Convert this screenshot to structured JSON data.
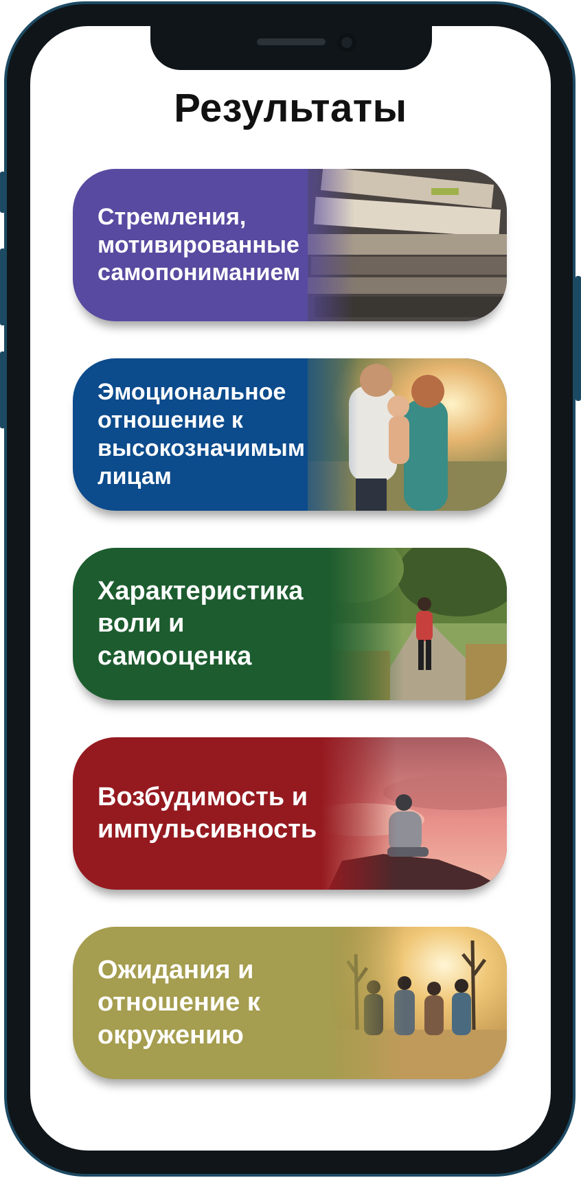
{
  "title": "Результаты",
  "cards": [
    {
      "label": "Стремления,\nмотивированные\nсамопониманием",
      "color": "#574aa0",
      "photo_icon": "books-photo"
    },
    {
      "label": "Эмоциональное\nотношение к\nвысокозначимым\nлицам",
      "color": "#0c4b8c",
      "photo_icon": "family-photo"
    },
    {
      "label": "Характеристика\nволи и\nсамооценка",
      "color": "#1d5c2f",
      "photo_icon": "walking-woman-photo"
    },
    {
      "label": "Возбудимость и\nимпульсивность",
      "color": "#951a20",
      "photo_icon": "person-on-rock-photo"
    },
    {
      "label": "Ожидания и\nотношение к\nокружению",
      "color": "#a59d4f",
      "photo_icon": "desert-group-photo"
    }
  ]
}
